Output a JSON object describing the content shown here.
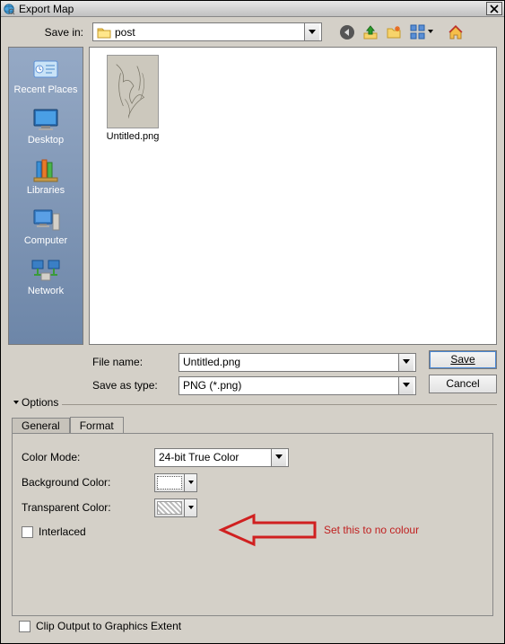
{
  "window": {
    "title": "Export Map"
  },
  "labels": {
    "save_in": "Save in:",
    "file_name": "File name:",
    "save_as_type": "Save as type:",
    "options": "Options",
    "color_mode": "Color Mode:",
    "background_color": "Background Color:",
    "transparent_color": "Transparent Color:",
    "interlaced": "Interlaced",
    "clip_output": "Clip Output to Graphics Extent"
  },
  "toolbar": {
    "back": "back",
    "up": "up",
    "new_folder": "new-folder",
    "view": "view",
    "home": "home"
  },
  "places": [
    {
      "key": "recent",
      "label": "Recent Places"
    },
    {
      "key": "desktop",
      "label": "Desktop"
    },
    {
      "key": "libraries",
      "label": "Libraries"
    },
    {
      "key": "computer",
      "label": "Computer"
    },
    {
      "key": "network",
      "label": "Network"
    }
  ],
  "save_in": {
    "folder": "post"
  },
  "files": [
    {
      "name": "Untitled.png"
    }
  ],
  "file_name": "Untitled.png",
  "save_as_type": "PNG (*.png)",
  "buttons": {
    "save": "Save",
    "cancel": "Cancel"
  },
  "tabs": {
    "general": "General",
    "format": "Format",
    "active": "format"
  },
  "format": {
    "color_mode_value": "24-bit True Color"
  },
  "annotation": {
    "text": "Set this to no colour"
  }
}
